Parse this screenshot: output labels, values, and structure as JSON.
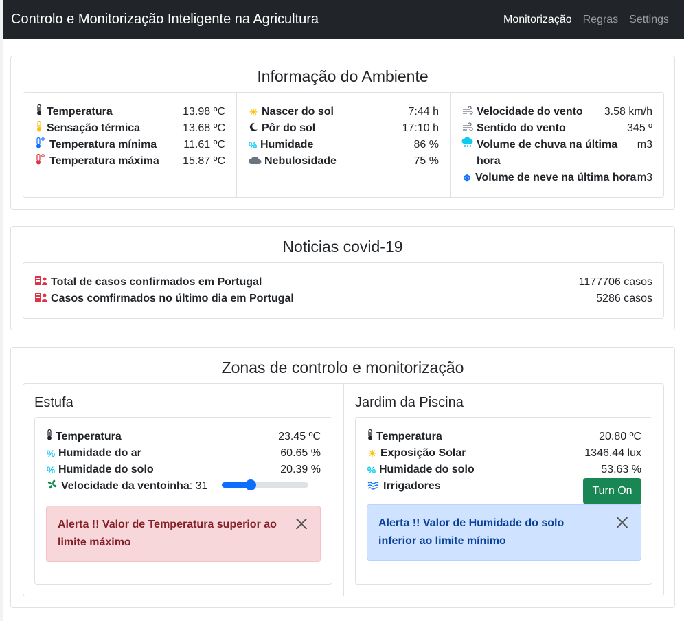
{
  "navbar": {
    "brand": "Controlo e Monitorização Inteligente na Agricultura",
    "links": [
      "Monitorização",
      "Regras",
      "Settings"
    ]
  },
  "ambiente": {
    "title": "Informação do Ambiente",
    "col1": [
      {
        "label": "Temperatura",
        "value": "13.98 ºC",
        "icon": "thermometer-icon"
      },
      {
        "label": "Sensação térmica",
        "value": "13.68 ºC",
        "icon": "thermometer-half-icon"
      },
      {
        "label": "Temperatura mínima",
        "value": "11.61 ºC",
        "icon": "thermometer-low-icon"
      },
      {
        "label": "Temperatura máxima",
        "value": "15.87 ºC",
        "icon": "thermometer-high-icon"
      }
    ],
    "col2": [
      {
        "label": "Nascer do sol",
        "value": "7:44 h",
        "icon": "sun-icon"
      },
      {
        "label": "Pôr do sol",
        "value": "17:10 h",
        "icon": "moon-icon"
      },
      {
        "label": "Humidade",
        "value": "86 %",
        "icon": "percent-icon"
      },
      {
        "label": "Nebulosidade",
        "value": "75 %",
        "icon": "cloud-icon"
      }
    ],
    "col3": [
      {
        "label": "Velocidade do vento",
        "value": "3.58 km/h",
        "icon": "wind-icon"
      },
      {
        "label": "Sentido do vento",
        "value": "345 º",
        "icon": "wind-icon"
      },
      {
        "label": "Volume de chuva na última hora",
        "value": "m3",
        "icon": "rain-icon"
      },
      {
        "label": "Volume de neve na última hora",
        "value": "m3",
        "icon": "snowflake-icon"
      }
    ]
  },
  "covid": {
    "title": "Noticias covid-19",
    "rows": [
      {
        "label": "Total de casos confirmados em Portugal",
        "value": "1177706 casos",
        "icon": "hospital-icon"
      },
      {
        "label": "Casos comfirmados no último dia em Portugal",
        "value": "5286 casos",
        "icon": "hospital-icon"
      }
    ]
  },
  "zonas": {
    "title": "Zonas de controlo e monitorização",
    "estufa": {
      "name": "Estufa",
      "rows": [
        {
          "label": "Temperatura",
          "value": "23.45 ºC",
          "icon": "thermometer-icon"
        },
        {
          "label": "Humidade do ar",
          "value": "60.65 %",
          "icon": "percent-icon"
        },
        {
          "label": "Humidade do solo",
          "value": "20.39 %",
          "icon": "percent-icon"
        }
      ],
      "fan_label": "Velocidade da ventoinha",
      "fan_value": ": 31",
      "fan_level": 0.31,
      "alert": "Alerta !! Valor de Temperatura superior ao limite máximo"
    },
    "jardim": {
      "name": "Jardim da Piscina",
      "rows": [
        {
          "label": "Temperatura",
          "value": "20.80 ºC",
          "icon": "thermometer-icon"
        },
        {
          "label": "Exposição Solar",
          "value": "1346.44 lux",
          "icon": "sun-icon"
        },
        {
          "label": "Humidade do solo",
          "value": "53.63 %",
          "icon": "percent-icon"
        }
      ],
      "irrigation_label": "Irrigadores",
      "button": "Turn On",
      "alert": "Alerta !! Valor de Humidade do solo inferior ao limite mínimo"
    }
  },
  "colors": {
    "navbar": "#212529",
    "thermo": "#212529",
    "sun": "#ffc107",
    "info": "#0dcaf0",
    "danger": "#dc3545",
    "primary": "#0d6efd",
    "success": "#198754"
  }
}
